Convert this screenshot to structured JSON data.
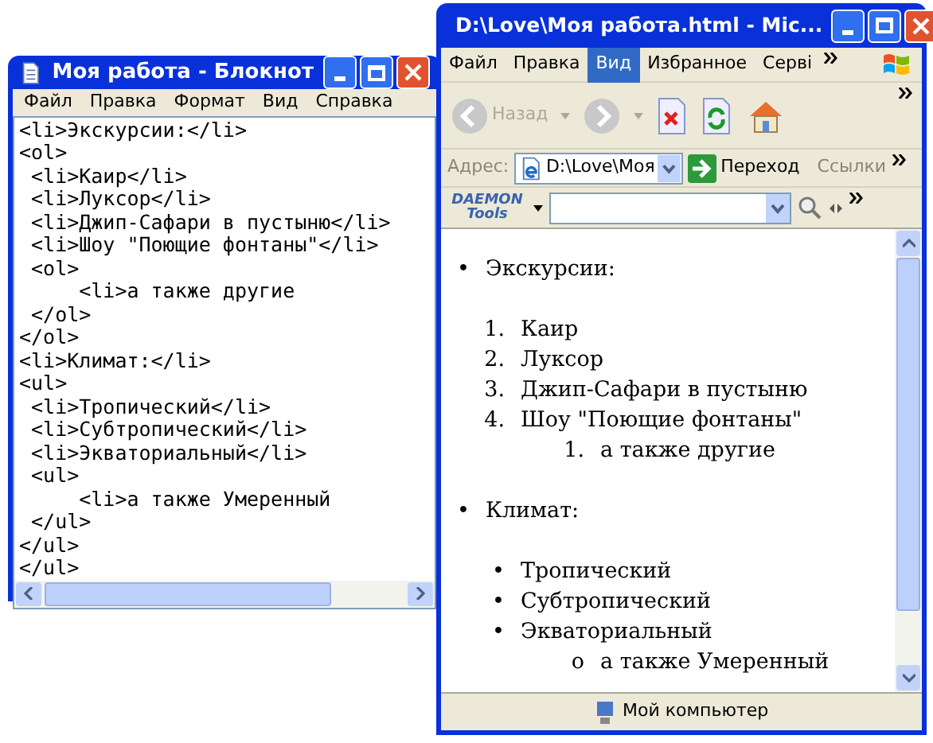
{
  "notepad": {
    "title": "Моя работа - Блокнот",
    "menu": [
      "Файл",
      "Правка",
      "Формат",
      "Вид",
      "Справка"
    ],
    "lines": [
      "<li>Экскурсии:</li>",
      "<ol>",
      " <li>Каир</li>",
      " <li>Луксор</li>",
      " <li>Джип-Сафари в пустыню</li>",
      " <li>Шоу \"Поющие фонтаны\"</li>",
      " <ol>",
      "     <li>а также другие",
      " </ol>",
      "</ol>",
      "<li>Климат:</li>",
      "<ul>",
      " <li>Тропический</li>",
      " <li>Субтропический</li>",
      " <li>Экваториальный</li>",
      " <ul>",
      "     <li>а также Умеренный",
      " </ul>",
      "</ul>",
      "</ul>"
    ]
  },
  "browser": {
    "title": "D:\\Love\\Моя работа.html - Mic...",
    "menu": [
      {
        "label": "Файл",
        "selected": false
      },
      {
        "label": "Правка",
        "selected": false
      },
      {
        "label": "Вид",
        "selected": true
      },
      {
        "label": "Избранное",
        "selected": false
      },
      {
        "label": "Серві",
        "selected": false
      }
    ],
    "back_label": "Назад",
    "address": {
      "label": "Адрес:",
      "value": "D:\\Love\\Моя",
      "go": "Переход",
      "links": "Ссылки"
    },
    "daemon": {
      "line1": "DAEMON",
      "line2": "Tools"
    },
    "content": [
      {
        "marker": "•",
        "text": "Экскурсии:",
        "children": [
          {
            "marker": "1.",
            "text": "Каир"
          },
          {
            "marker": "2.",
            "text": "Луксор"
          },
          {
            "marker": "3.",
            "text": "Джип-Сафари в пустыню"
          },
          {
            "marker": "4.",
            "text": "Шоу \"Поющие фонтаны\"",
            "children": [
              {
                "marker": "1.",
                "text": "а также другие"
              }
            ]
          }
        ]
      },
      {
        "marker": "•",
        "text": "Климат:",
        "children": [
          {
            "marker": "•",
            "text": "Тропический"
          },
          {
            "marker": "•",
            "text": "Субтропический"
          },
          {
            "marker": "•",
            "text": "Экваториальный",
            "children": [
              {
                "marker": "o",
                "text": "а также Умеренный"
              }
            ]
          }
        ]
      }
    ],
    "status": "Мой компьютер"
  }
}
